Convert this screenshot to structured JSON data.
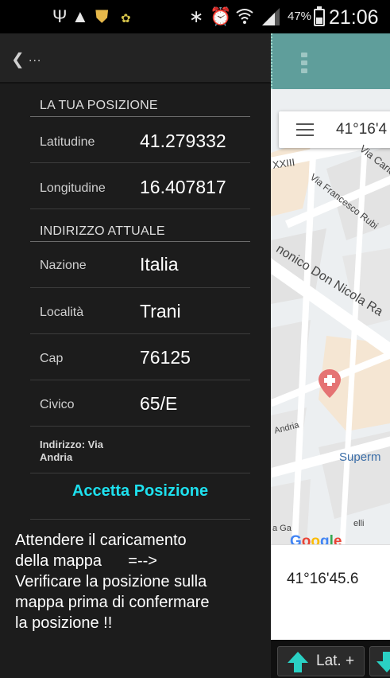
{
  "status_bar": {
    "battery_percent": "47%",
    "battery_level": 0.47,
    "time": "21:06",
    "icons": [
      "usb-icon",
      "warning-icon",
      "shield-icon",
      "app-icon",
      "bluetooth-icon",
      "alarm-icon",
      "wifi-icon",
      "signal-icon",
      "battery-icon"
    ]
  },
  "drawer": {
    "header": {
      "dots": "..."
    },
    "position_section": {
      "title": "LA TUA POSIZIONE",
      "latitude_label": "Latitudine",
      "latitude_value": "41.279332",
      "longitude_label": "Longitudine",
      "longitude_value": "16.407817"
    },
    "address_section": {
      "title": "INDIRIZZO ATTUALE",
      "country_label": "Nazione",
      "country_value": "Italia",
      "city_label": "Località",
      "city_value": "Trani",
      "zip_label": "Cap",
      "zip_value": "76125",
      "number_label": "Civico",
      "number_value": "65/E",
      "address_line1": "Indirizzo: Via",
      "address_line2": "Andria"
    },
    "accept_button": "Accetta Posizione",
    "notes": [
      "Attendere il caricamento",
      "della mappa      =-->",
      "Verificare la posizione sulla",
      "mappa prima di confermare",
      "la posizione !!"
    ]
  },
  "map": {
    "search_coord": "41°16'4",
    "labels": {
      "xxiii": "XXIII",
      "via_cario": "Via Cario",
      "via_francesco": "Via Francesco Rubi",
      "canonico": "nonico Don Nicola Ra",
      "andria": "Andria",
      "superm": "Superm",
      "gatti": "a Ga",
      "elli": "elli"
    },
    "google_logo": "Google",
    "colors": {
      "accent": "#1ee0ee",
      "topbar": "#5f9e9b",
      "pin": "#e57373"
    }
  },
  "coord_display": "41°16'45.6",
  "buttons": {
    "lat_plus": "Lat. +"
  }
}
